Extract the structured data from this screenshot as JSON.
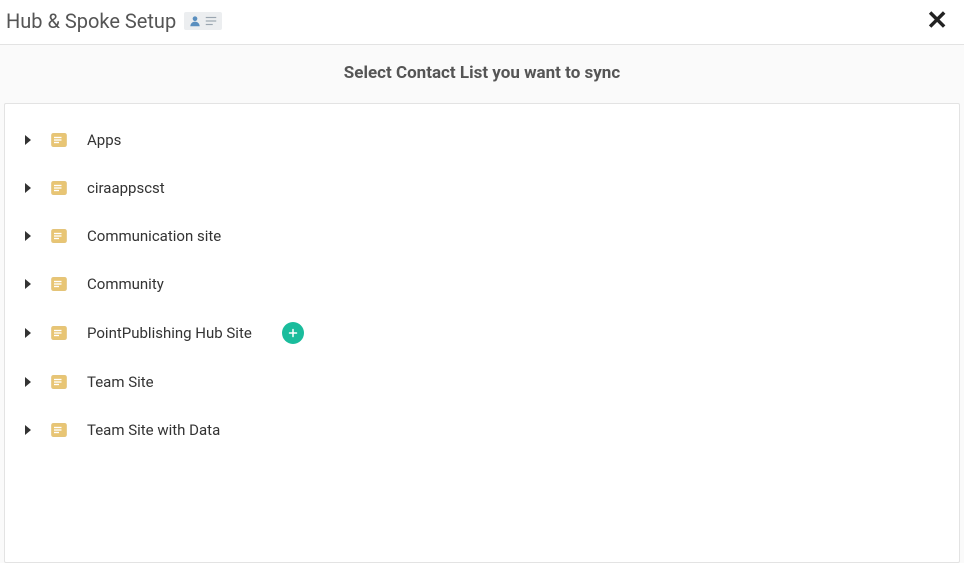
{
  "header": {
    "title": "Hub & Spoke Setup",
    "close_label": "✕"
  },
  "subheader": "Select Contact List you want to sync",
  "icons": {
    "person": "person-icon",
    "list": "list-icon",
    "folder": "folder-icon",
    "caret": "expand-caret-icon",
    "add": "add-icon"
  },
  "colors": {
    "folder_fill": "#e8c574",
    "folder_stroke": "#d9b25a",
    "add_bg": "#1abc9c",
    "person_fill": "#5a8fbf"
  },
  "tree": [
    {
      "label": "Apps",
      "has_add": false
    },
    {
      "label": "ciraappscst",
      "has_add": false
    },
    {
      "label": "Communication site",
      "has_add": false
    },
    {
      "label": "Community",
      "has_add": false
    },
    {
      "label": "PointPublishing Hub Site",
      "has_add": true
    },
    {
      "label": "Team Site",
      "has_add": false
    },
    {
      "label": "Team Site with Data",
      "has_add": false
    }
  ]
}
